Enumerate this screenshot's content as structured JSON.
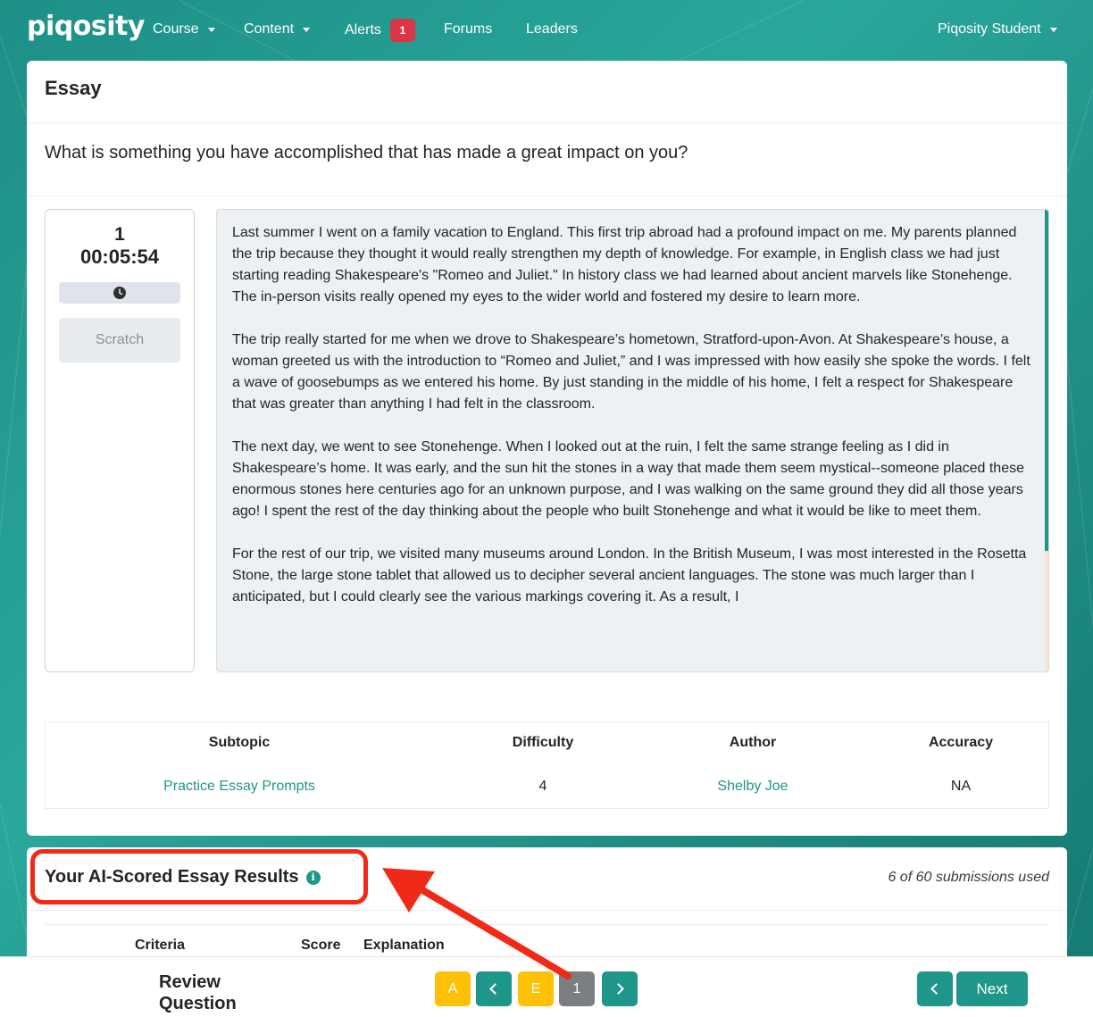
{
  "nav": {
    "brand": "piqosity",
    "items": [
      {
        "label": "Course"
      },
      {
        "label": "Content"
      },
      {
        "label": "Alerts",
        "badge": "1"
      },
      {
        "label": "Forums"
      },
      {
        "label": "Leaders"
      }
    ],
    "user": "Piqosity Student"
  },
  "essay": {
    "title": "Essay",
    "prompt": "What is something you have accomplished that has made a great impact on you?",
    "timer": {
      "count": "1",
      "clock": "00:05:54"
    },
    "scratch_label": "Scratch",
    "text": "Last summer I went on a family vacation to England. This first trip abroad had a profound impact on me. My parents planned the trip because they thought it would really strengthen my depth of knowledge. For example, in English class we had just starting reading Shakespeare's \"Romeo and Juliet.\" In history class we had learned about ancient marvels like Stonehenge. The in-person visits really opened my eyes to the wider world and fostered my desire to learn more.\n\nThe trip really started for me when we drove to Shakespeare’s hometown, Stratford-upon-Avon. At Shakespeare’s house, a woman greeted us with the introduction to “Romeo and Juliet,” and I was impressed with how easily she spoke the words. I felt a wave of goosebumps as we entered his home. By just standing in the middle of his home, I felt a respect for Shakespeare that was greater than anything I had felt in the classroom.\n\nThe next day, we went to see Stonehenge. When I looked out at the ruin, I felt the same strange feeling as I did in Shakespeare’s home. It was early, and the sun hit the stones in a way that made them seem mystical--someone placed these enormous stones here centuries ago for an unknown purpose, and I was walking on the same ground they did all those years ago! I spent the rest of the day thinking about the people who built Stonehenge and what it would be like to meet them.\n\nFor the rest of our trip, we visited many museums around London. In the British Museum, I was most interested in the Rosetta Stone, the large stone tablet that allowed us to decipher several ancient languages. The stone was much larger than I anticipated, but I could clearly see the various markings covering it. As a result, I"
  },
  "meta": {
    "headers": [
      "Subtopic",
      "Difficulty",
      "Author",
      "Accuracy"
    ],
    "values": [
      "Practice Essay Prompts",
      "4",
      "Shelby Joe",
      "NA"
    ]
  },
  "results": {
    "title": "Your AI-Scored Essay Results",
    "info_icon": "info-icon",
    "submissions": "6 of 60 submissions used",
    "columns": [
      "Criteria",
      "Score",
      "Explanation"
    ]
  },
  "bottom": {
    "review_label_line1": "Review",
    "review_label_line2": "Question",
    "btn_a": "A",
    "btn_e": "E",
    "btn_page": "1",
    "next_label": "Next"
  },
  "colors": {
    "teal": "#1f968a",
    "yellow": "#ffc107",
    "gray": "#7a7f84",
    "alert_red": "#dc3545",
    "annotation_red": "#f02a17"
  }
}
